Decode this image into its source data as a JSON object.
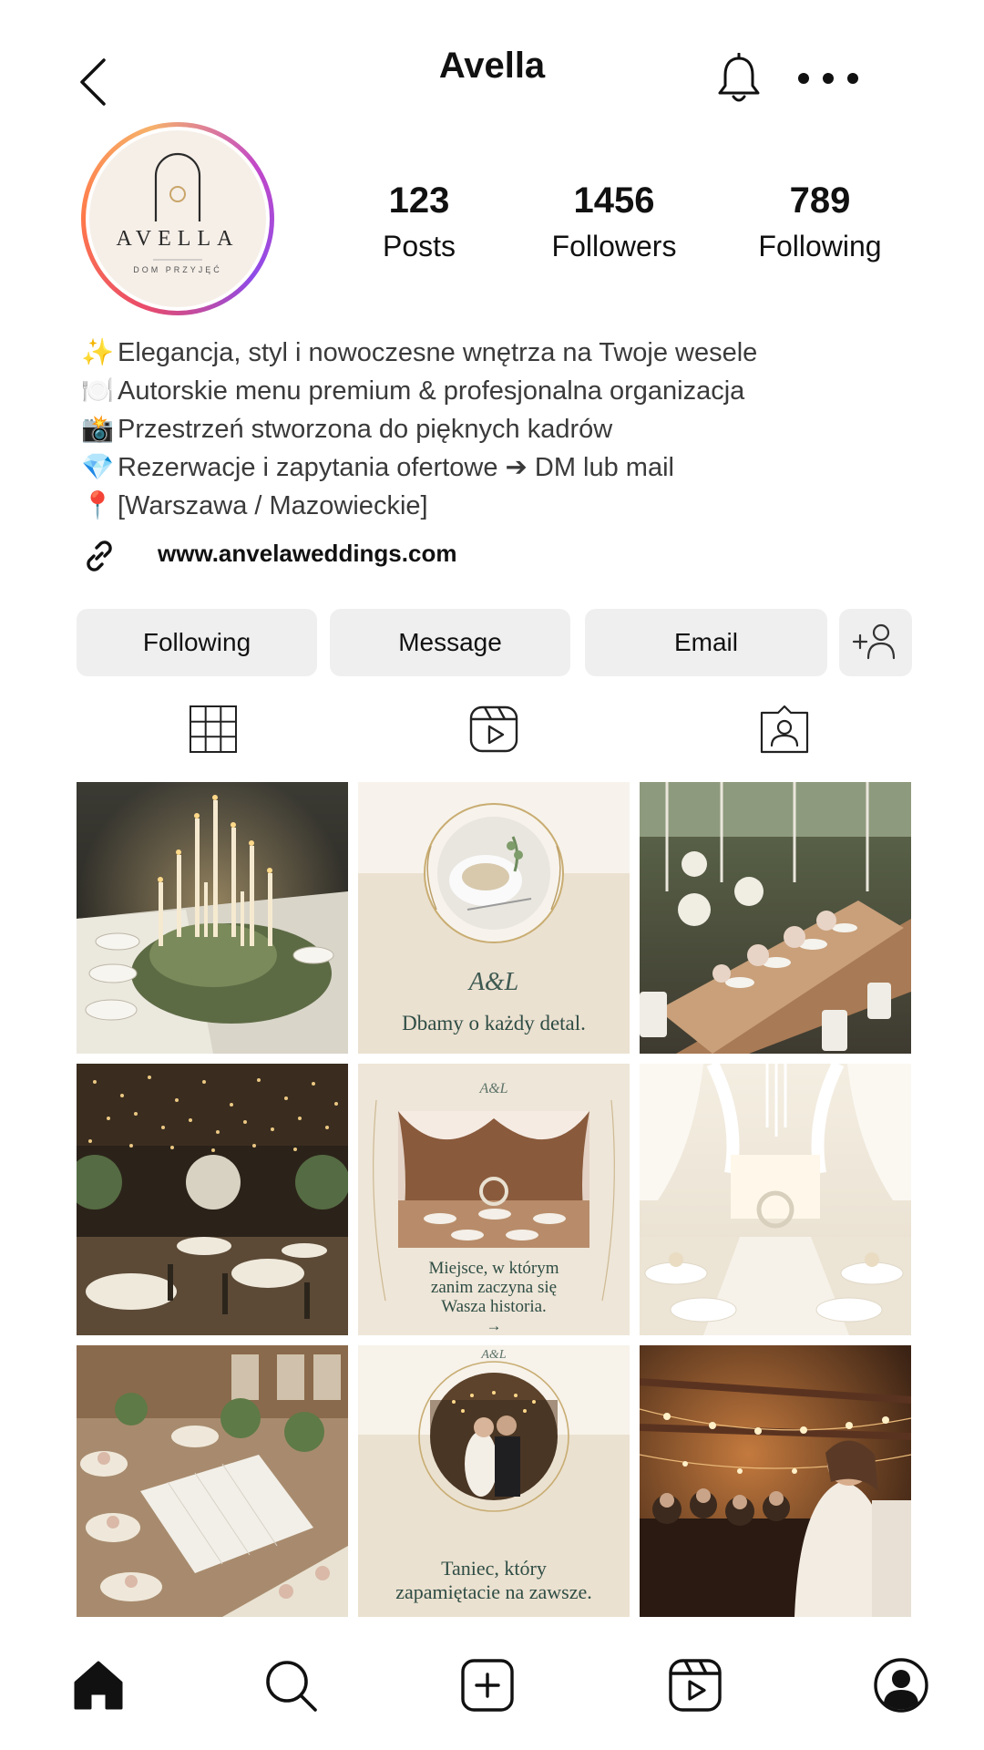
{
  "header": {
    "title": "Avella",
    "back_icon": "chevron-left-icon",
    "bell_icon": "bell-icon",
    "more_icon": "more-horizontal-icon"
  },
  "profile": {
    "avatar": {
      "logo_text": "AVELLA",
      "logo_subtext": "DOM PRZYJĘĆ"
    },
    "stats": {
      "posts": {
        "value": "123",
        "label": "Posts"
      },
      "followers": {
        "value": "1456",
        "label": "Followers"
      },
      "following": {
        "value": "789",
        "label": "Following"
      }
    },
    "bio": [
      {
        "emoji": "✨",
        "text": "Elegancja, styl i nowoczesne wnętrza na Twoje wesele"
      },
      {
        "emoji": "🍽️",
        "text": "Autorskie menu premium & profesjonalna organizacja"
      },
      {
        "emoji": "📸",
        "text": "Przestrzeń stworzona do pięknych kadrów"
      },
      {
        "emoji": "💎",
        "text": "Rezerwacje i zapytania ofertowe ➔ DM lub mail"
      },
      {
        "emoji": "📍",
        "text": "[Warszawa / Mazowieckie]"
      }
    ],
    "link": {
      "icon": "link-icon",
      "url": "www.anvelaweddings.com"
    }
  },
  "actions": {
    "following": "Following",
    "message": "Message",
    "email": "Email",
    "add_user_icon": "add-user-icon"
  },
  "tabs": [
    {
      "icon": "grid-icon",
      "active": true
    },
    {
      "icon": "reels-icon",
      "active": false
    },
    {
      "icon": "tagged-icon",
      "active": false
    }
  ],
  "posts": {
    "captions": {
      "post2": "Dbamy o każdy detal.",
      "post5_line1": "Miejsce, w którym",
      "post5_line2": "zanim zaczyna się",
      "post5_line3": "Wasza historia.",
      "post5_arrow": "→",
      "post8_line1": "Taniec, który",
      "post8_line2": "zapamiętacie na zawsze."
    }
  },
  "bottom_nav": [
    {
      "icon": "home-icon"
    },
    {
      "icon": "search-icon"
    },
    {
      "icon": "create-icon"
    },
    {
      "icon": "reels-icon"
    },
    {
      "icon": "profile-icon"
    }
  ],
  "colors": {
    "button_bg": "#efefef",
    "caption_green": "#2f4d45",
    "cream": "#efe6d8"
  }
}
